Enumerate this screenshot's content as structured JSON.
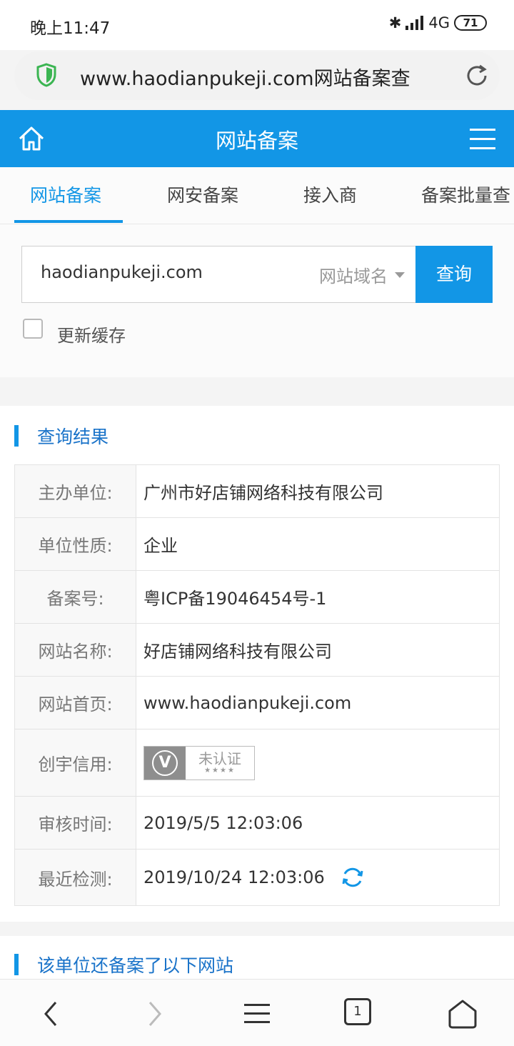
{
  "status": {
    "time": "晚上11:47",
    "network": "4G",
    "battery": "71"
  },
  "browser": {
    "url": "www.haodianpukeji.com网站备案查"
  },
  "appbar": {
    "title": "网站备案"
  },
  "tabs": [
    {
      "label": "网站备案",
      "active": true
    },
    {
      "label": "网安备案",
      "active": false
    },
    {
      "label": "接入商",
      "active": false
    },
    {
      "label": "备案批量查",
      "active": false
    }
  ],
  "search": {
    "value": "haodianpukeji.com",
    "type_select": "网站域名",
    "button": "查询",
    "checkbox_label": "更新缓存",
    "checkbox_checked": false
  },
  "results": {
    "title": "查询结果",
    "rows": [
      {
        "label": "主办单位:",
        "value": "广州市好店铺网络科技有限公司"
      },
      {
        "label": "单位性质:",
        "value": "企业"
      },
      {
        "label": "备案号:",
        "value": "粤ICP备19046454号-1"
      },
      {
        "label": "网站名称:",
        "value": "好店铺网络科技有限公司"
      },
      {
        "label": "网站首页:",
        "value": "www.haodianpukeji.com"
      },
      {
        "label": "创宇信用:",
        "badge_letter": "V",
        "badge_text": "未认证",
        "badge_stars": "★★★★"
      },
      {
        "label": "审核时间:",
        "value": "2019/5/5 12:03:06"
      },
      {
        "label": "最近检测:",
        "value": "2019/10/24 12:03:06"
      }
    ]
  },
  "more": {
    "title": "该单位还备案了以下网站"
  },
  "bottom_nav": {
    "tab_count": "1"
  },
  "colors": {
    "accent": "#1296e6",
    "title_blue": "#1a73c9"
  }
}
